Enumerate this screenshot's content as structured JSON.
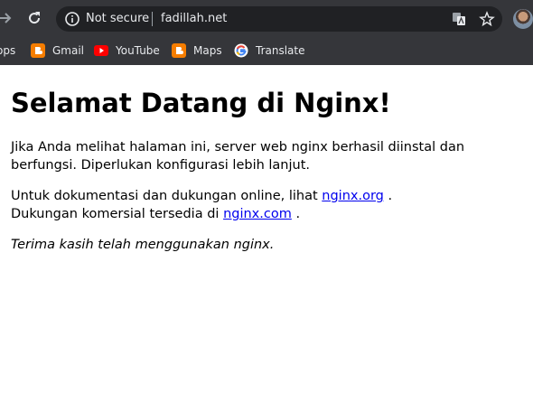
{
  "browser": {
    "security_label": "Not secure",
    "url": "fadillah.net"
  },
  "bookmarks": {
    "items": [
      {
        "label": "ops",
        "icon": "apps-icon"
      },
      {
        "label": "Gmail",
        "icon": "blogger-icon"
      },
      {
        "label": "YouTube",
        "icon": "youtube-icon"
      },
      {
        "label": "Maps",
        "icon": "blogger-icon"
      },
      {
        "label": "Translate",
        "icon": "google-icon"
      }
    ]
  },
  "page": {
    "heading": "Selamat Datang di Nginx!",
    "para1": "Jika Anda melihat halaman ini, server web nginx berhasil diinstal dan berfungsi. Diperlukan konfigurasi lebih lanjut.",
    "para2_prefix": "Untuk dokumentasi dan dukungan online, lihat ",
    "link1": "nginx.org",
    "para2_mid": " .",
    "para2_line2": "Dukungan komersial tersedia di ",
    "link2": "nginx.com",
    "para2_suffix": " .",
    "para3": "Terima kasih telah menggunakan nginx."
  },
  "colors": {
    "chrome_bg": "#35363a",
    "omnibox_bg": "#202124",
    "link": "#0000ee",
    "blogger_orange": "#f57d00",
    "youtube_red": "#ff0000"
  }
}
